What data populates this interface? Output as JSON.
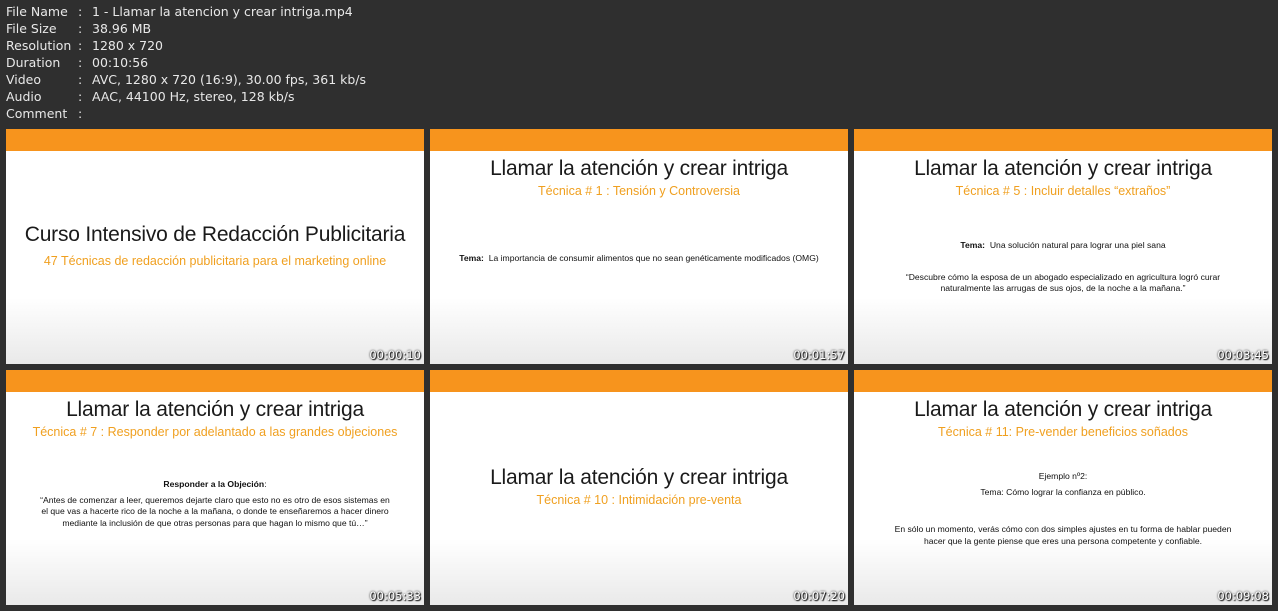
{
  "meta": [
    {
      "key": "File Name",
      "value": "1 - Llamar la atencion y crear intriga.mp4"
    },
    {
      "key": "File Size",
      "value": "38.96 MB"
    },
    {
      "key": "Resolution",
      "value": "1280 x 720"
    },
    {
      "key": "Duration",
      "value": "00:10:56"
    },
    {
      "key": "Video",
      "value": "AVC, 1280 x 720 (16:9), 30.00 fps, 361 kb/s"
    },
    {
      "key": "Audio",
      "value": "AAC, 44100 Hz, stereo, 128 kb/s"
    },
    {
      "key": "Comment",
      "value": ""
    }
  ],
  "separator": ":",
  "thumbnails": [
    {
      "title": "Curso Intensivo de Redacción Publicitaria",
      "subtitle": "47 Técnicas de redacción publicitaria para el marketing online",
      "timestamp": "00:00:10"
    },
    {
      "title": "Llamar la atención y crear intriga",
      "subtitle": "Técnica # 1 : Tensión y Controversia",
      "label": "Tema:",
      "text": "La importancia de consumir alimentos que no sean genéticamente modificados (OMG)",
      "timestamp": "00:01:57"
    },
    {
      "title": "Llamar la atención y crear intriga",
      "subtitle": "Técnica # 5 : Incluir detalles “extraños”",
      "label": "Tema:",
      "text": "Una solución natural para lograr una piel sana",
      "quote": "“Descubre cómo la esposa de un abogado especializado en agricultura logró curar naturalmente las arrugas de sus ojos, de la noche a la mañana.”",
      "timestamp": "00:03:45"
    },
    {
      "title": "Llamar la atención y crear intriga",
      "subtitle": "Técnica # 7 : Responder por adelantado a las grandes objeciones",
      "label": "Responder a la Objeción",
      "label_suffix": ":",
      "quote": "“Antes de comenzar a leer, queremos dejarte claro que esto no es otro de esos sistemas en el que vas a hacerte rico de la noche a la mañana, o donde te enseñaremos a hacer dinero mediante la inclusión de que otras personas para que hagan lo mismo que tú…”",
      "timestamp": "00:05:33"
    },
    {
      "title": "Llamar la atención y crear intriga",
      "subtitle": "Técnica # 10 : Intimidación pre-venta",
      "timestamp": "00:07:20"
    },
    {
      "title": "Llamar la atención y crear intriga",
      "subtitle": "Técnica # 11: Pre-vender beneficios soñados",
      "example": "Ejemplo nº2:",
      "topic": "Tema: Cómo lograr la confianza en público.",
      "text": "En sólo un momento, verás cómo con dos simples ajustes en tu forma de hablar pueden hacer que la gente piense que eres una persona competente y confiable.",
      "timestamp": "00:09:08"
    }
  ],
  "colors": {
    "accent_bar": "#f7941d",
    "subtitle": "#f0a020",
    "background": "#2f2f2f"
  }
}
